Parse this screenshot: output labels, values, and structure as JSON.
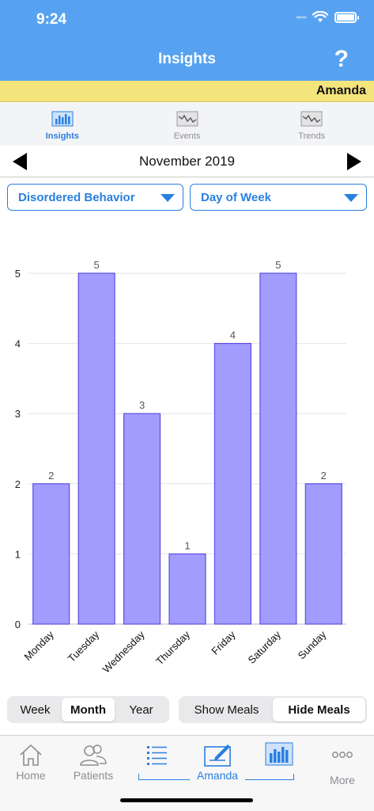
{
  "status": {
    "time": "9:24"
  },
  "nav": {
    "title": "Insights",
    "help": "?"
  },
  "user": {
    "name": "Amanda"
  },
  "tabs": [
    {
      "label": "Insights",
      "icon": "bar-chart-icon",
      "active": true
    },
    {
      "label": "Events",
      "icon": "line-graph-icon",
      "active": false
    },
    {
      "label": "Trends",
      "icon": "line-graph-icon",
      "active": false
    }
  ],
  "period": {
    "label": "November 2019"
  },
  "filters": {
    "category": "Disordered Behavior",
    "grouping": "Day of Week"
  },
  "chart_data": {
    "type": "bar",
    "categories": [
      "Monday",
      "Tuesday",
      "Wednesday",
      "Thursday",
      "Friday",
      "Saturday",
      "Sunday"
    ],
    "values": [
      2,
      5,
      3,
      1,
      4,
      5,
      2
    ],
    "ylim": [
      0,
      5
    ],
    "yticks": [
      0,
      1,
      2,
      3,
      4,
      5
    ],
    "grid": true,
    "colors": {
      "bar": "#a39cff",
      "bar_border": "#5b4fe0"
    }
  },
  "range_segment": {
    "options": [
      "Week",
      "Month",
      "Year"
    ],
    "selected": "Month"
  },
  "meals_segment": {
    "options": [
      "Show Meals",
      "Hide Meals"
    ],
    "selected": "Hide Meals"
  },
  "bottom_tabs": {
    "home": "Home",
    "patients": "Patients",
    "amanda": "Amanda",
    "more": "More"
  },
  "colors": {
    "header": "#57a2f0",
    "user_bar": "#f4e47c",
    "accent": "#2a7fe0"
  }
}
